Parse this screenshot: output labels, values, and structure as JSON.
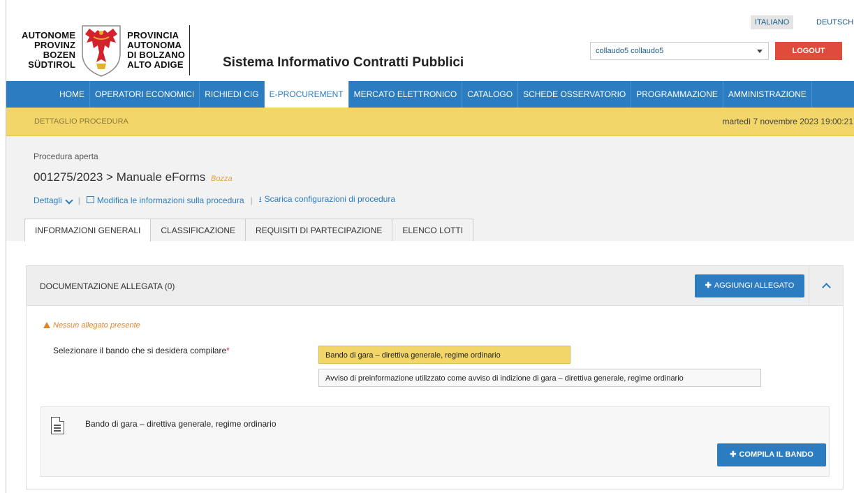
{
  "brand": {
    "left_lines": [
      "AUTONOME",
      "PROVINZ",
      "BOZEN",
      "SÜDTIROL"
    ],
    "right_lines": [
      "PROVINCIA",
      "AUTONOMA",
      "DI BOLZANO",
      "ALTO ADIGE"
    ],
    "app_title": "Sistema Informativo Contratti Pubblici"
  },
  "header": {
    "lang_it": "ITALIANO",
    "lang_de": "DEUTSCH",
    "user": "collaudo5 collaudo5",
    "logout": "LOGOUT"
  },
  "nav": {
    "items": [
      "HOME",
      "OPERATORI ECONOMICI",
      "RICHIEDI CIG",
      "E-PROCUREMENT",
      "MERCATO ELETTRONICO",
      "CATALOGO",
      "SCHEDE OSSERVATORIO",
      "PROGRAMMAZIONE",
      "AMMINISTRAZIONE"
    ],
    "active": "E-PROCUREMENT"
  },
  "subbar": {
    "crumb": "DETTAGLIO PROCEDURA",
    "datetime": "martedì 7 novembre 2023 19:00:21"
  },
  "procedure": {
    "type": "Procedura aperta",
    "code": "001275/2023",
    "separator": ">",
    "name": "Manuale eForms",
    "status": "Bozza",
    "details_link": "Dettagli",
    "edit_link": "Modifica le informazioni sulla procedura",
    "download_link": "Scarica configurazioni di procedura",
    "link_sep": "|"
  },
  "tabs": [
    "INFORMAZIONI GENERALI",
    "CLASSIFICAZIONE",
    "REQUISITI DI PARTECIPAZIONE",
    "ELENCO LOTTI"
  ],
  "panel": {
    "title": "DOCUMENTAZIONE ALLEGATA (0)",
    "add_button": "AGGIUNGI ALLEGATO",
    "empty_warning": "Nessun allegato presente",
    "select_label": "Selezionare il bando che si desidera compilare",
    "required_mark": "*",
    "options": [
      "Bando di gara – direttiva generale, regime ordinario",
      "Avviso di preinformazione utilizzato come avviso di indizione di gara – direttiva generale, regime ordinario"
    ],
    "selected_option_index": 0,
    "card_title": "Bando di gara – direttiva generale, regime ordinario",
    "compile_button": "COMPILA IL BANDO"
  },
  "colors": {
    "primary": "#2b7cc0",
    "accent_yellow": "#f2d66a",
    "logout_red": "#e04c3c",
    "warning": "#e0842a"
  }
}
